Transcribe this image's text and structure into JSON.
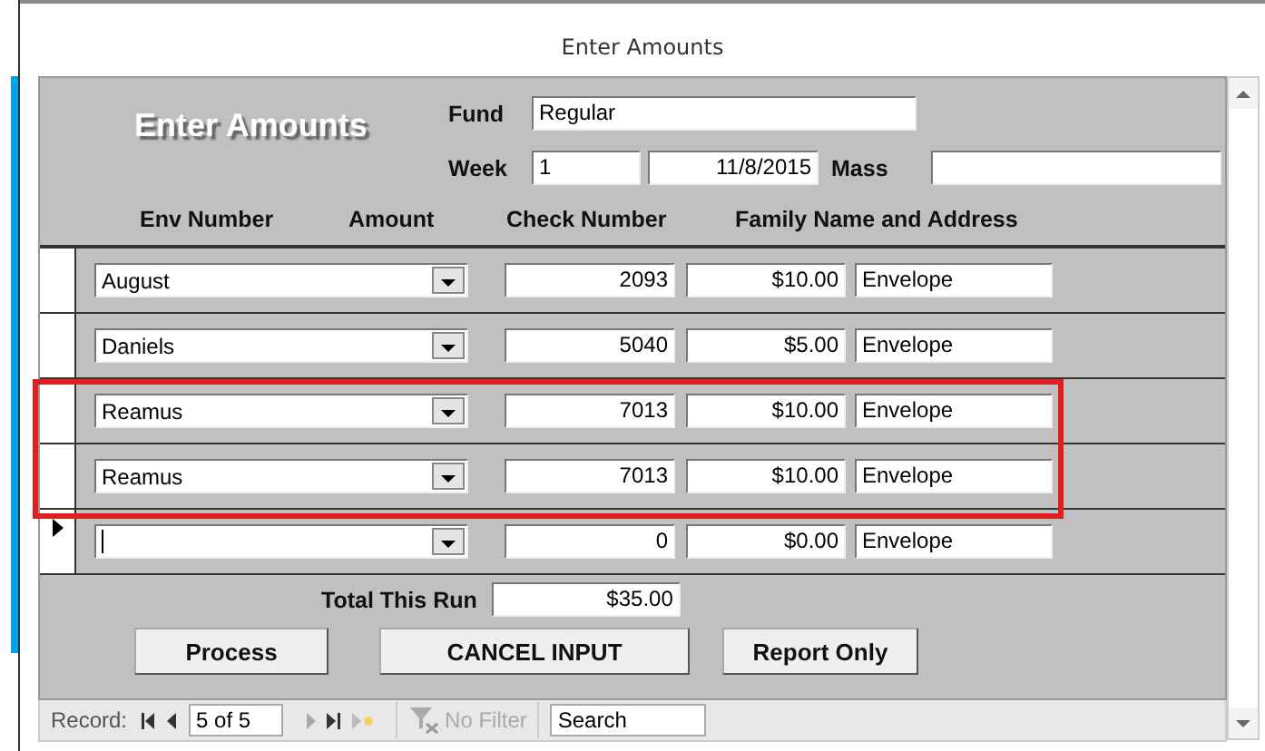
{
  "window": {
    "title": "Enter Amounts"
  },
  "header": {
    "heading": "Enter Amounts",
    "fund": {
      "label": "Fund",
      "value": "Regular"
    },
    "week": {
      "label": "Week",
      "value": "1",
      "date": "11/8/2015"
    },
    "mass": {
      "label": "Mass"
    }
  },
  "columns": [
    "Env Number",
    "Amount",
    "Check Number",
    "Family Name and Address"
  ],
  "rows": [
    {
      "name": "August",
      "check_number": "2093",
      "amount": "$10.00",
      "family": "Envelope",
      "current": false
    },
    {
      "name": "Daniels",
      "check_number": "5040",
      "amount": "$5.00",
      "family": "Envelope",
      "current": false
    },
    {
      "name": "Reamus",
      "check_number": "7013",
      "amount": "$10.00",
      "family": "Envelope",
      "current": false
    },
    {
      "name": "Reamus",
      "check_number": "7013",
      "amount": "$10.00",
      "family": "Envelope",
      "current": false
    },
    {
      "name": "",
      "check_number": "0",
      "amount": "$0.00",
      "family": "Envelope",
      "current": true
    }
  ],
  "total": {
    "label": "Total This Run",
    "value": "$35.00"
  },
  "buttons": [
    "Process",
    "CANCEL INPUT",
    "Report Only"
  ],
  "navigation": {
    "label": "Record:",
    "position": "5 of 5",
    "filter": "No Filter",
    "search": "Search"
  }
}
